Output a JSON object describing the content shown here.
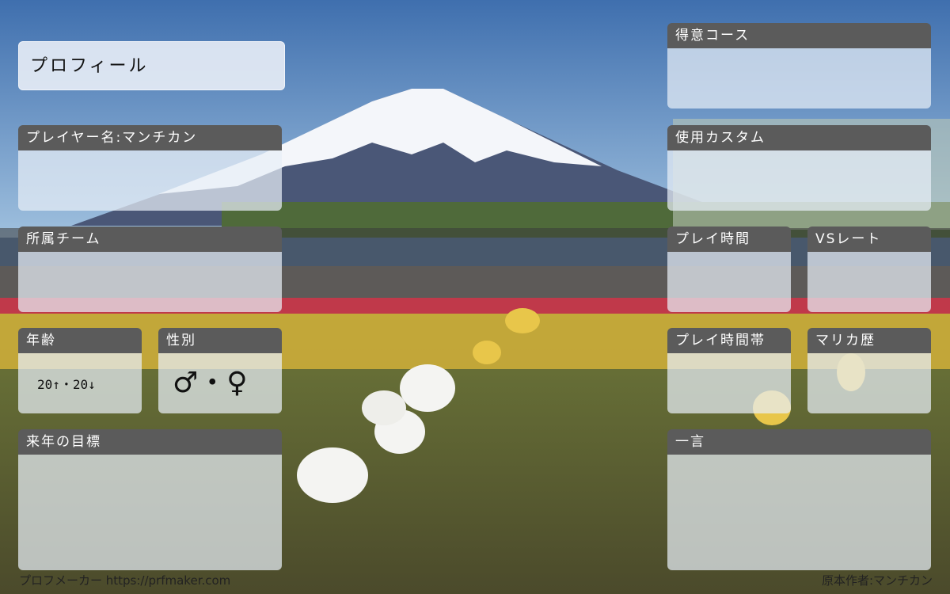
{
  "title": "プロフィール",
  "panels": {
    "player_name": "プレイヤー名:マンチカン",
    "team": "所属チーム",
    "age": "年齢",
    "age_value": "20↑・20↓",
    "gender": "性別",
    "gender_value": "♂・♀",
    "goal": "来年の目標",
    "course": "得意コース",
    "custom": "使用カスタム",
    "play_time": "プレイ時間",
    "vs_rate": "VSレート",
    "play_hours": "プレイ時間帯",
    "history": "マリカ歴",
    "comment": "一言"
  },
  "footer": {
    "maker": "プロフメーカー https://prfmaker.com",
    "author": "原本作者:マンチカン"
  }
}
